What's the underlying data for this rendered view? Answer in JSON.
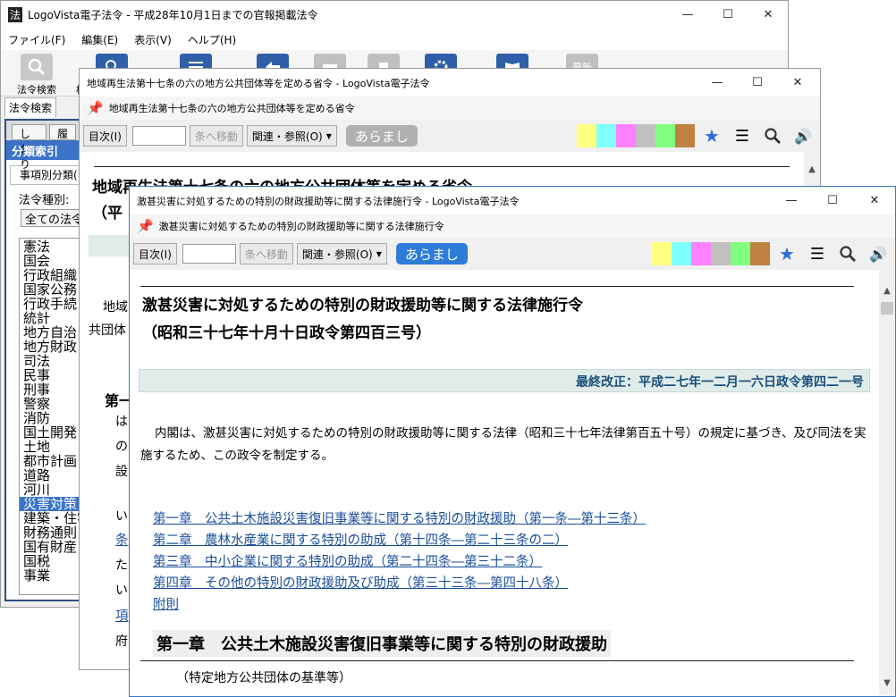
{
  "main_window": {
    "app_icon": "法",
    "title": "LogoVista電子法令 - 平成28年10月1日までの官報掲載法令",
    "controls": {
      "minimize": "—",
      "maximize": "☐",
      "close": "✕"
    },
    "menu": [
      "ファイル(F)",
      "編集(E)",
      "表示(V)",
      "ヘルプ(H)"
    ],
    "toolbar": [
      {
        "label": "法令検索",
        "icon": "search-icon"
      },
      {
        "label": "検",
        "icon": "search-doc-icon"
      },
      {
        "label": "",
        "icon": "list-icon"
      },
      {
        "label": "",
        "icon": "back-arrow-icon"
      },
      {
        "label": "",
        "icon": "print-icon"
      },
      {
        "label": "",
        "icon": "copy-icon"
      },
      {
        "label": "",
        "icon": "gear-icon"
      },
      {
        "label": "",
        "icon": "book-icon"
      },
      {
        "label": "最新",
        "icon": "newest-icon"
      }
    ],
    "left_tabs": [
      "法令検索"
    ],
    "left_subtabs": [
      "しおり",
      "履"
    ],
    "left_section": "分類索引",
    "category_tab": "事項別分類(",
    "law_type_label": "法令種別:",
    "law_type_value": "全ての法令",
    "categories": [
      "憲法",
      "国会",
      "行政組織",
      "国家公務",
      "行政手続",
      "統計",
      "地方自治",
      "地方財政",
      "司法",
      "民事",
      "刑事",
      "警察",
      "消防",
      "国土開発",
      "土地",
      "都市計画",
      "道路",
      "河川",
      "災害対策",
      "建築・住宅",
      "財務通則",
      "国有財産",
      "国税",
      "事業"
    ],
    "selected_category": "災害対策"
  },
  "window2": {
    "title": "地域再生法第十七条の六の地方公共団体等を定める省令 - LogoVista電子法令",
    "caption": "地域再生法第十七条の六の地方公共団体等を定める省令",
    "controls": {
      "minimize": "—",
      "maximize": "☐",
      "close": "✕"
    },
    "nav": {
      "toc": "目次(I)",
      "goto": "条へ移動",
      "related": "関連・参照(O)",
      "summary": "あらまし"
    },
    "doc_title": "地域再生法第十七条の六の地方公共団体等を定める省令",
    "doc_subtitle": "（平",
    "body_fragments": [
      "地域",
      "共団体",
      "第一",
      "は",
      "の",
      "設",
      "い",
      "条",
      "た",
      "い",
      "項",
      "府"
    ]
  },
  "window3": {
    "title": "激甚災害に対処するための特別の財政援助等に関する法律施行令 - LogoVista電子法令",
    "caption": "激甚災害に対処するための特別の財政援助等に関する法律施行令",
    "controls": {
      "minimize": "—",
      "maximize": "☐",
      "close": "✕"
    },
    "nav": {
      "toc": "目次(I)",
      "goto": "条へ移動",
      "related": "関連・参照(O)",
      "summary": "あらまし"
    },
    "doc_title": "激甚災害に対処するための特別の財政援助等に関する法律施行令",
    "doc_subtitle": "（昭和三十七年十月十日政令第四百三号）",
    "last_revision": "最終改正：平成二七年一二月一六日政令第四二一号",
    "preamble": "内閣は、激甚災害に対処するための特別の財政援助等に関する法律（昭和三十七年法律第百五十号）の規定に基づき、及び同法を実施するため、この政令を制定する。",
    "chapters": [
      "第一章　公共土木施設災害復旧事業等に関する特別の財政援助（第一条―第十三条）",
      "第二章　農林水産業に関する特別の助成（第十四条―第二十三条の二）",
      "第三章　中小企業に関する特別の助成（第二十四条―第三十二条）",
      "第四章　その他の特別の財政援助及び助成（第三十三条―第四十八条）",
      "附則"
    ],
    "chapter_heading": "第一章　公共土木施設災害復旧事業等に関する特別の財政援助",
    "next_heading": "（特定地方公共団体の基準等）"
  },
  "swatch_colors": [
    "#ffff80",
    "#80ffff",
    "#ff80ff",
    "#c0c0c0",
    "#80ff80",
    "#c08040"
  ],
  "accent_blue": "#2f7bd8"
}
